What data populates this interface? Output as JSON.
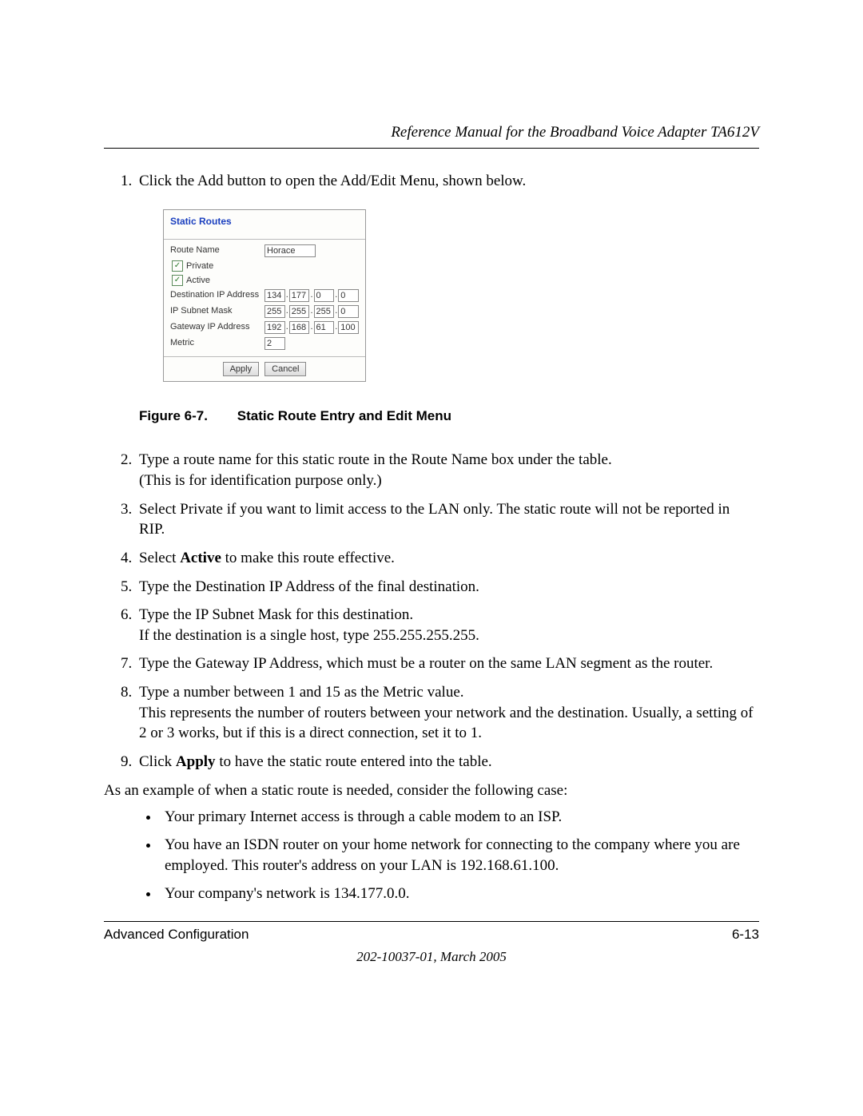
{
  "header": {
    "running_title": "Reference Manual for the Broadband Voice Adapter TA612V"
  },
  "steps": {
    "s1": "Click the Add button to open the Add/Edit Menu, shown below.",
    "s2a": "Type a route name for this static route in the Route Name box under the table.",
    "s2b": "(This is for identification purpose only.)",
    "s3": "Select Private if you want to limit access to the LAN only. The static route will not be reported in RIP.",
    "s4_pre": "Select ",
    "s4_bold": "Active",
    "s4_post": " to make this route effective.",
    "s5": "Type the Destination IP Address of the final destination.",
    "s6a": "Type the IP Subnet Mask for this destination.",
    "s6b": "If the destination is a single host, type 255.255.255.255.",
    "s7": "Type the Gateway IP Address, which must be a router on the same LAN segment as the router.",
    "s8a": "Type a number between 1 and 15 as the Metric value.",
    "s8b": "This represents the number of routers between your network and the destination. Usually, a setting of 2 or 3 works, but if this is a direct connection, set it to 1.",
    "s9_pre": "Click ",
    "s9_bold": "Apply",
    "s9_post": " to have the static route entered into the table."
  },
  "example_intro": "As an example of when a static route is needed, consider the following case:",
  "bullets": {
    "b1": "Your primary Internet access is through a cable modem to an ISP.",
    "b2": "You have an ISDN router on your home network for connecting to the company where you are employed. This router's address on your LAN is 192.168.61.100.",
    "b3": "Your company's network is 134.177.0.0."
  },
  "figure": {
    "label": "Figure 6-7.",
    "caption": "Static Route Entry and Edit Menu"
  },
  "screenshot": {
    "title": "Static Routes",
    "labels": {
      "route_name": "Route Name",
      "private": "Private",
      "active": "Active",
      "dest_ip": "Destination IP Address",
      "subnet": "IP Subnet Mask",
      "gateway": "Gateway IP Address",
      "metric": "Metric"
    },
    "values": {
      "route_name": "Horace",
      "private_checked": "✓",
      "active_checked": "✓",
      "dest": [
        "134",
        "177",
        "0",
        "0"
      ],
      "mask": [
        "255",
        "255",
        "255",
        "0"
      ],
      "gw": [
        "192",
        "168",
        "61",
        "100"
      ],
      "metric": "2"
    },
    "buttons": {
      "apply": "Apply",
      "cancel": "Cancel"
    }
  },
  "footer": {
    "left": "Advanced Configuration",
    "right": "6-13",
    "docnum": "202-10037-01, March 2005"
  }
}
